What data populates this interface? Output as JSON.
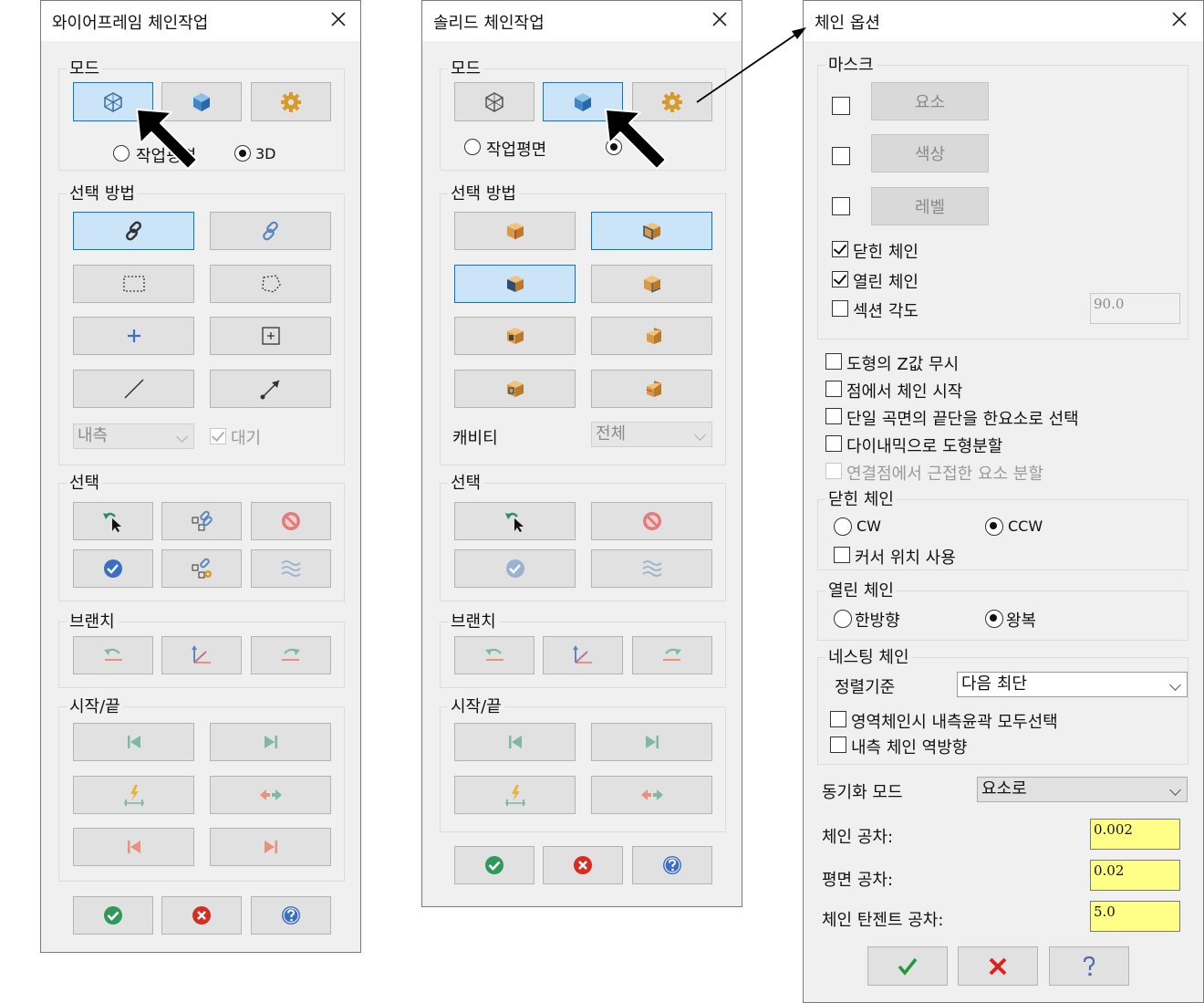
{
  "wireframe": {
    "title": "와이어프레임 체인작업",
    "mode": {
      "label": "모드",
      "radio_plane": "작업평면",
      "radio_3d": "3D"
    },
    "select_method": {
      "label": "선택 방법",
      "dropdown": "내측",
      "wait": "대기"
    },
    "select": {
      "label": "선택"
    },
    "branch": {
      "label": "브랜치"
    },
    "startend": {
      "label": "시작/끝"
    }
  },
  "solid": {
    "title": "솔리드 체인작업",
    "mode": {
      "label": "모드",
      "radio_plane": "작업평면"
    },
    "select_method": {
      "label": "선택 방법",
      "cavity_label": "캐비티",
      "cavity_value": "전체"
    },
    "select": {
      "label": "선택"
    },
    "branch": {
      "label": "브랜치"
    },
    "startend": {
      "label": "시작/끝"
    }
  },
  "options": {
    "title": "체인 옵션",
    "mask": {
      "label": "마스크",
      "entity_btn": "요소",
      "color_btn": "색상",
      "level_btn": "레벨",
      "closed": "닫힌 체인",
      "open": "열린 체인",
      "section_angle": "섹션 각도",
      "section_angle_value": "90.0"
    },
    "ignore_z": "도형의 Z값 무시",
    "start_at_point": "점에서 체인 시작",
    "single_surface": "단일 곡면의 끝단을 한요소로 선택",
    "dynamic_split": "다이내믹으로 도형분할",
    "split_near": "연결점에서 근접한 요소 분할",
    "closed_chain": {
      "label": "닫힌 체인",
      "cw": "CW",
      "ccw": "CCW",
      "cursor": "커서 위치 사용"
    },
    "open_chain": {
      "label": "열린 체인",
      "one_way": "한방향",
      "round_trip": "왕복"
    },
    "nesting": {
      "label": "네스팅 체인",
      "sort_label": "정렬기준",
      "sort_value": "다음 최단",
      "select_all": "영역체인시 내측윤곽 모두선택",
      "reverse_inner": "내측 체인 역방향"
    },
    "sync_mode": {
      "label": "동기화 모드",
      "value": "요소로"
    },
    "chain_tol": {
      "label": "체인 공차:",
      "value": "0.002"
    },
    "plane_tol": {
      "label": "평면 공차:",
      "value": "0.02"
    },
    "tangent_tol": {
      "label": "체인 탄젠트 공차:",
      "value": "5.0"
    }
  },
  "colors": {
    "selected_bg": "#cce4f7",
    "selected_border": "#0078d7",
    "tolerance_bg": "#ffff88",
    "ok": "#2e9a5a",
    "cancel": "#d62d20",
    "help": "#3b6fc4"
  }
}
